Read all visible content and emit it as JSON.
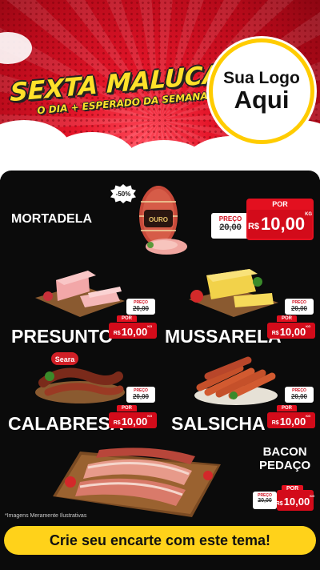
{
  "header": {
    "title": "SEXTA MALUCA!",
    "subtitle": "O DIA + ESPERADO DA SEMANA",
    "logo_line1": "Sua Logo",
    "logo_line2": "Aqui"
  },
  "badge": "-50%",
  "products": [
    {
      "name": "MORTADELA",
      "old_label": "PREÇO",
      "old_price": "20,00",
      "new_label": "POR",
      "currency": "R$",
      "new_price": "10,00",
      "unit": "KG",
      "brand": "OURO"
    },
    {
      "name": "PRESUNTO",
      "old_label": "PREÇO",
      "old_price": "20,00",
      "new_label": "POR",
      "currency": "R$",
      "new_price": "10,00",
      "unit": "KG"
    },
    {
      "name": "MUSSARELA",
      "old_label": "PREÇO",
      "old_price": "20,00",
      "new_label": "POR",
      "currency": "R$",
      "new_price": "10,00",
      "unit": "KG"
    },
    {
      "name": "CALABRESA",
      "old_label": "PREÇO",
      "old_price": "20,00",
      "new_label": "POR",
      "currency": "R$",
      "new_price": "10,00",
      "unit": "KG",
      "brand": "Seara"
    },
    {
      "name": "SALSICHA",
      "old_label": "PREÇO",
      "old_price": "20,00",
      "new_label": "POR",
      "currency": "R$",
      "new_price": "10,00",
      "unit": "KG"
    },
    {
      "name_line1": "BACON",
      "name_line2": "PEDAÇO",
      "old_label": "PREÇO",
      "old_price": "20,00",
      "new_label": "POR",
      "currency": "R$",
      "new_price": "10,00",
      "unit": "KG"
    }
  ],
  "footnote": "*Imagens Meramente Ilustrativas",
  "cta": "Crie seu encarte com este tema!",
  "colors": {
    "accent_red": "#e3101f",
    "yellow": "#ffd21a",
    "background": "#0b0b0b"
  }
}
